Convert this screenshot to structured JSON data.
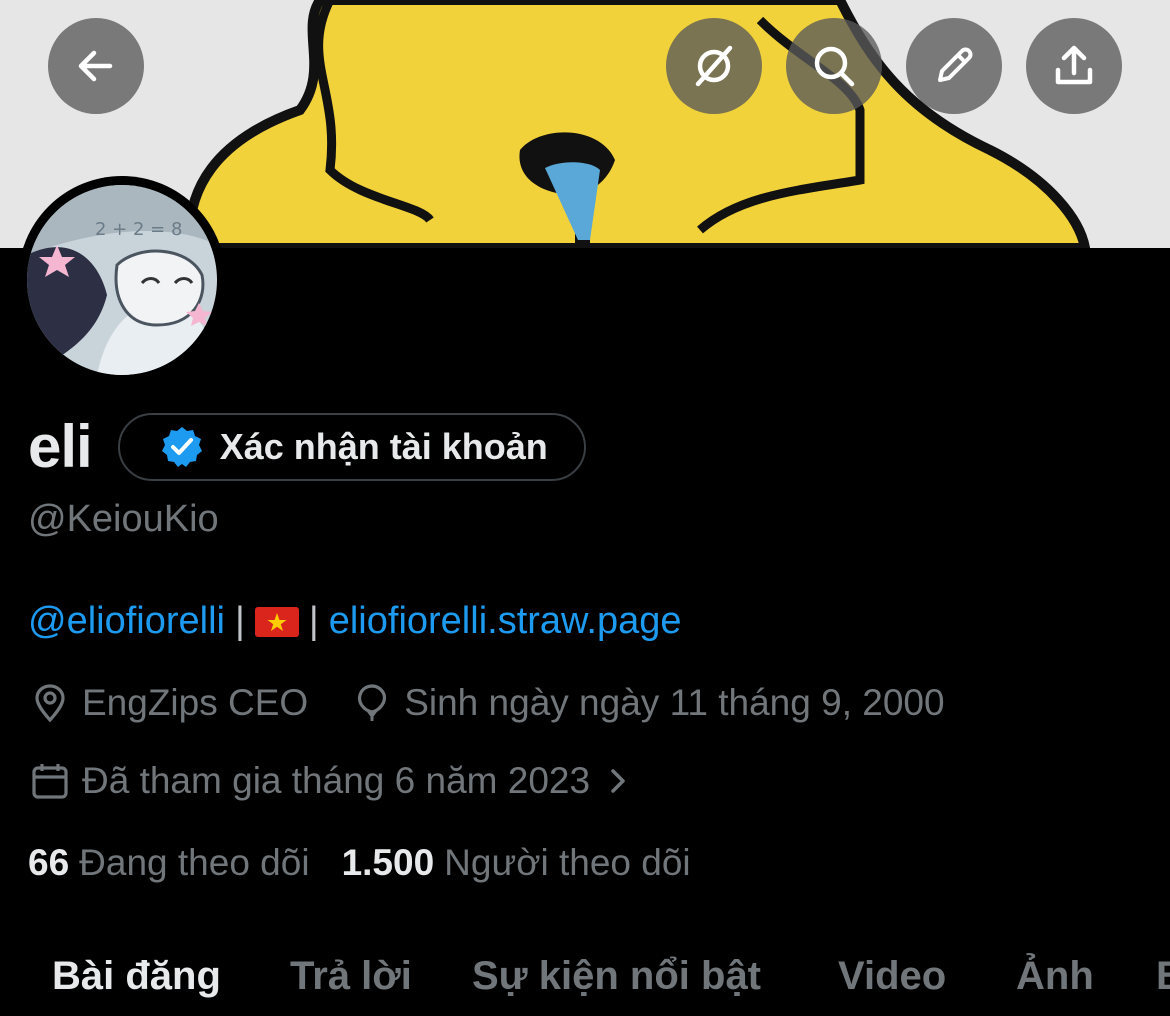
{
  "header": {
    "icons": [
      "back-arrow-icon",
      "grok-icon",
      "search-icon",
      "edit-pencil-icon",
      "share-icon"
    ]
  },
  "profile": {
    "name": "eli",
    "verify_button_label": "Xác nhận tài khoản",
    "handle": "@KeiouKio",
    "bio": {
      "mention": "@eliofiorelli",
      "separator": "|",
      "flag_icon": "vietnam-flag-icon",
      "link": "eliofiorelli.straw.page"
    },
    "location": "EngZips CEO",
    "birthday": "Sinh ngày ngày 11 tháng 9, 2000",
    "joined": "Đã tham gia tháng 6 năm 2023"
  },
  "stats": {
    "following_count": "66",
    "following_label": "Đang theo dõi",
    "followers_count": "1.500",
    "followers_label": "Người theo dõi"
  },
  "tabs": [
    {
      "label": "Bài đăng",
      "active": true
    },
    {
      "label": "Trả lời",
      "active": false
    },
    {
      "label": "Sự kiện nổi bật",
      "active": false
    },
    {
      "label": "Video",
      "active": false
    },
    {
      "label": "Ảnh",
      "active": false
    },
    {
      "label": "B",
      "active": false
    }
  ],
  "colors": {
    "background": "#000000",
    "text_primary": "#e7e9ea",
    "text_secondary": "#71767b",
    "link": "#1d9bf0",
    "verified_badge": "#1d9bf0",
    "banner_yellow": "#f2d23a"
  }
}
